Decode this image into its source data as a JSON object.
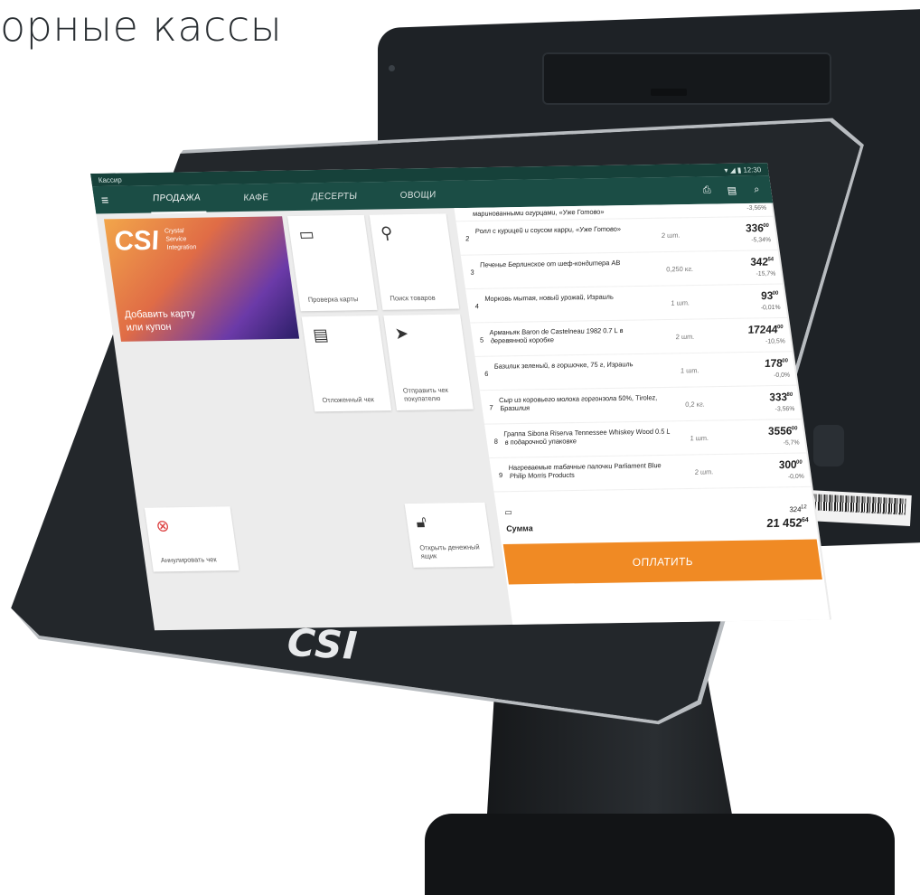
{
  "heading": "орные кассы",
  "device": {
    "logo": "CSI"
  },
  "rear_display": {
    "barcode_text": "AMI131000012150001"
  },
  "status_bar": {
    "app_name": "Кассир",
    "time": "12:30"
  },
  "tabs": [
    {
      "label": "ПРОДАЖА",
      "active": true
    },
    {
      "label": "КАФЕ",
      "active": false
    },
    {
      "label": "ДЕСЕРТЫ",
      "active": false
    },
    {
      "label": "ОВОЩИ",
      "active": false
    }
  ],
  "promo": {
    "brand": "CSI",
    "tagline_1": "Crystal",
    "tagline_2": "Service",
    "tagline_3": "Integration",
    "cta_1": "Добавить карту",
    "cta_2": "или купон"
  },
  "actions": {
    "check_card": "Проверка карты",
    "search_goods": "Поиск товаров",
    "deferred_check": "Отложенный чек",
    "send_check": "Отправить чек покупателю",
    "cancel_check": "Аннулировать чек",
    "open_drawer": "Открыть денежный ящик"
  },
  "receipt": {
    "partial_top": "маринованными огурцами, «Уже Готово»",
    "partial_top_disc": "-3,56%",
    "items": [
      {
        "num": "2",
        "name": "Ролл с курицей и соусом карри, «Уже Готово»",
        "qty": "2 шт.",
        "price": "336",
        "cents": "00",
        "disc": "-5,34%"
      },
      {
        "num": "3",
        "name": "Печенье Берлинское от шеф-кондитера АВ",
        "qty": "0,250 кг.",
        "price": "342",
        "cents": "54",
        "disc": "-15,7%"
      },
      {
        "num": "4",
        "name": "Морковь мытая, новый урожай, Израиль",
        "qty": "1 шт.",
        "price": "93",
        "cents": "00",
        "disc": "-0,01%"
      },
      {
        "num": "5",
        "name": "Арманьяк Baron de Castelneau 1982 0.7 L в деревянной коробке",
        "qty": "2 шт.",
        "price": "17244",
        "cents": "00",
        "disc": "-10,5%"
      },
      {
        "num": "6",
        "name": "Базилик зеленый, в горшочке, 75 г, Израиль",
        "qty": "1 шт.",
        "price": "178",
        "cents": "00",
        "disc": "-0,0%"
      },
      {
        "num": "7",
        "name": "Сыр из коровьего молока горгонзола 50%, Tirolez, Бразилия",
        "qty": "0,2 кг.",
        "price": "333",
        "cents": "80",
        "disc": "-3,56%"
      },
      {
        "num": "8",
        "name": "Граппа Sibona Riserva Tennessee Whiskey Wood 0.5 L в подарочной упаковке",
        "qty": "1 шт.",
        "price": "3556",
        "cents": "00",
        "disc": "-5,7%"
      },
      {
        "num": "9",
        "name": "Нагреваемые табачные палочки Parliament Blue Philip Morris Products",
        "qty": "2 шт.",
        "price": "300",
        "cents": "00",
        "disc": "-0,0%"
      }
    ],
    "tax_value": "324",
    "tax_cents": "12",
    "sum_label": "Сумма",
    "sum_value": "21 452",
    "sum_cents": "64",
    "pay_button": "ОПЛАТИТЬ"
  }
}
